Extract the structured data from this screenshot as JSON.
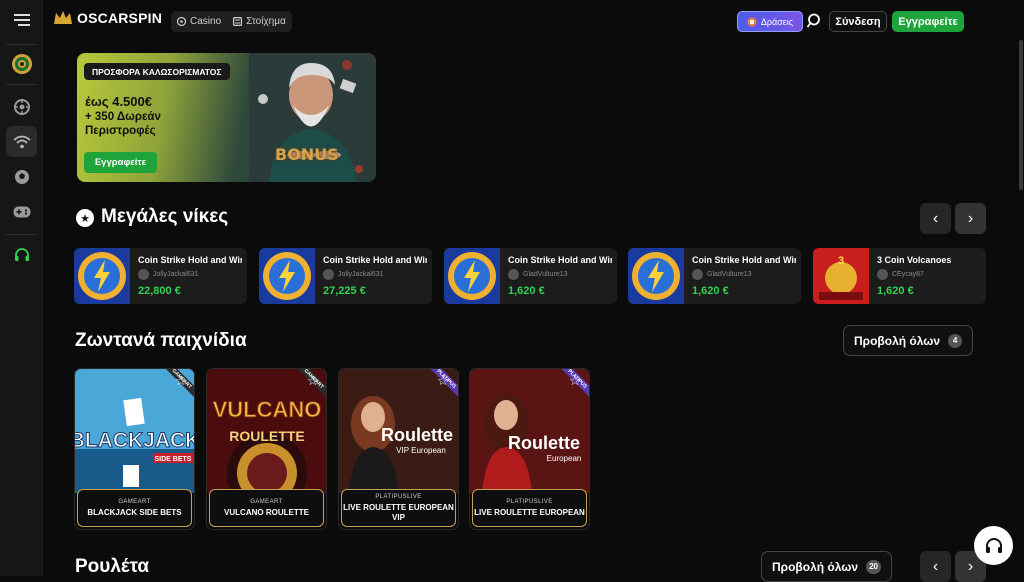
{
  "header": {
    "logo_text": "OSCARSPIN",
    "tabs": [
      {
        "label": "Casino",
        "icon": "casino-icon"
      },
      {
        "label": "Στοίχημα",
        "icon": "sports-icon"
      }
    ],
    "actions_label": "Δράσεις",
    "login_label": "Σύνδεση",
    "register_label": "Εγγραφείτε"
  },
  "sidebar": {
    "items": [
      {
        "icon": "menu-icon"
      },
      {
        "icon": "roulette-wheel-icon"
      },
      {
        "icon": "live-casino-icon"
      },
      {
        "icon": "live-stream-icon"
      },
      {
        "icon": "football-icon"
      },
      {
        "icon": "gamepad-icon"
      },
      {
        "icon": "headset-icon"
      }
    ]
  },
  "promo": {
    "tag": "ΠΡΟΣΦΟΡΑ ΚΑΛΩΣΟΡΙΣΜΑΤΟΣ",
    "amount": "έως 4.500€",
    "spins": "+ 350 Δωρεάν Περιστροφές",
    "button": "Εγγραφείτε",
    "bonus_word": "BONUS"
  },
  "big_wins": {
    "title": "Μεγάλες νίκες",
    "items": [
      {
        "game": "Coin Strike Hold and Win",
        "user": "JollyJackal631",
        "amount": "22,800 €"
      },
      {
        "game": "Coin Strike Hold and Win",
        "user": "JollyJackal631",
        "amount": "27,225 €"
      },
      {
        "game": "Coin Strike Hold and Win",
        "user": "GladVulture13",
        "amount": "1,620 €"
      },
      {
        "game": "Coin Strike Hold and Win",
        "user": "GladVulture13",
        "amount": "1,620 €"
      },
      {
        "game": "3 Coin Volcanoes",
        "user": "CEycay87",
        "amount": "1,620 €"
      }
    ]
  },
  "live_games": {
    "title": "Ζωντανά παιχνίδια",
    "view_all": "Προβολή όλων",
    "count": "4",
    "items": [
      {
        "provider": "GAMEART",
        "name": "BLACKJACK SIDE BETS",
        "art_title": "BLACKJACK",
        "art_sub": "SIDE BETS",
        "ribbon": "GAMEART"
      },
      {
        "provider": "GAMEART",
        "name": "VULCANO ROULETTE",
        "art_title": "VULCANO",
        "art_sub": "ROULETTE",
        "ribbon": "GAMEART"
      },
      {
        "provider": "PLATIPUSLIVE",
        "name": "LIVE ROULETTE EUROPEAN VIP",
        "art_title": "Roulette",
        "art_sub": "VIP European",
        "ribbon": "PLATIPUS"
      },
      {
        "provider": "PLATIPUSLIVE",
        "name": "LIVE ROULETTE EUROPEAN",
        "art_title": "Roulette",
        "art_sub": "European",
        "ribbon": "PLATIPUS"
      }
    ]
  },
  "roulette": {
    "title": "Ρουλέτα",
    "view_all": "Προβολή όλων",
    "count": "20"
  },
  "colors": {
    "accent_green": "#1fa33b",
    "win_green": "#32d14f",
    "gold_border": "#c7a351",
    "actions_purple": "#6a58e8"
  }
}
